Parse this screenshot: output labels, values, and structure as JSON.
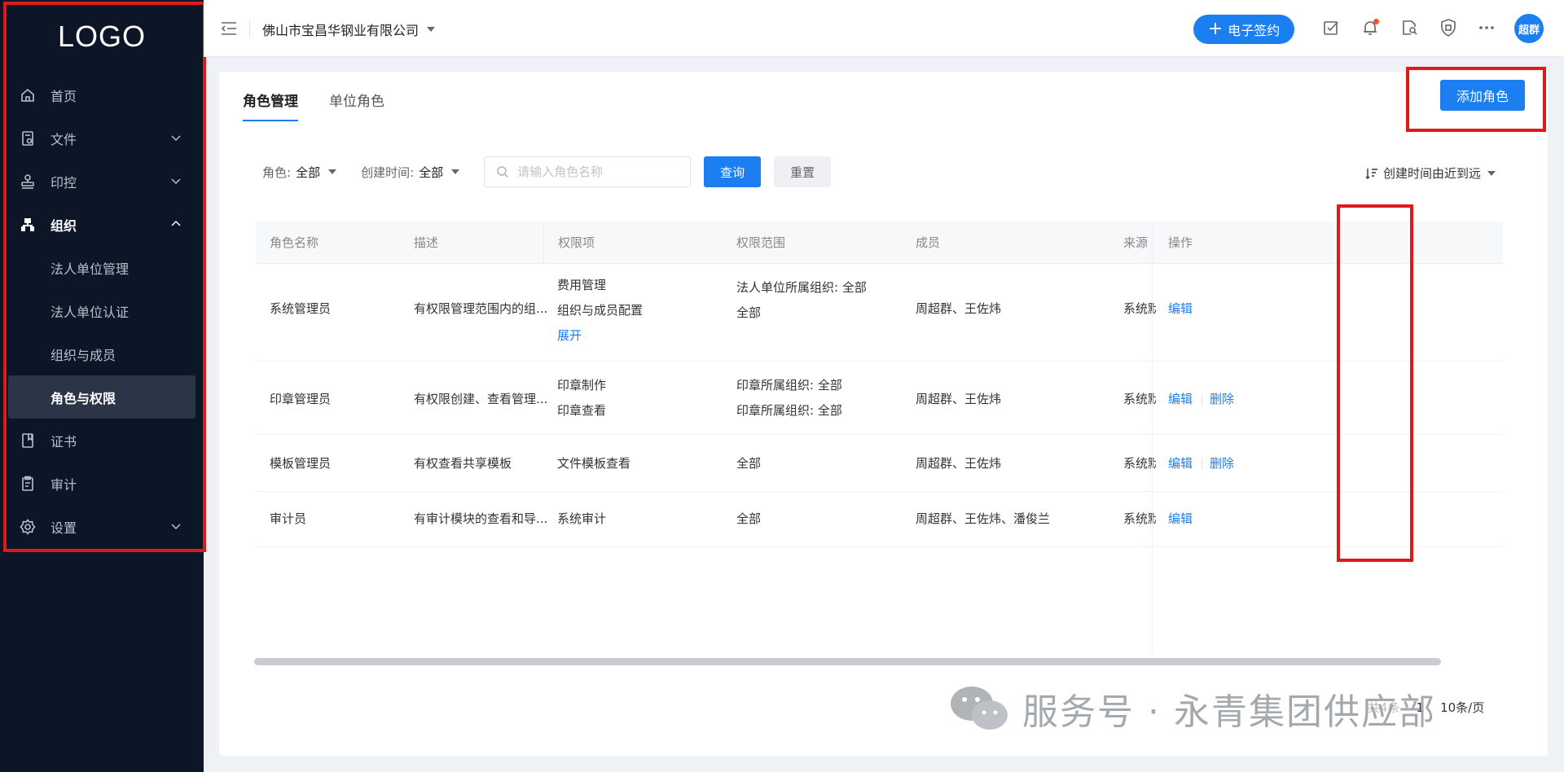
{
  "sidebar": {
    "logo": "LOGO",
    "items": [
      {
        "label": "首页",
        "icon": "home-icon"
      },
      {
        "label": "文件",
        "icon": "file-icon"
      },
      {
        "label": "印控",
        "icon": "stamp-icon"
      },
      {
        "label": "组织",
        "icon": "org-icon"
      },
      {
        "label": "证书",
        "icon": "certificate-icon"
      },
      {
        "label": "审计",
        "icon": "audit-icon"
      },
      {
        "label": "设置",
        "icon": "gear-icon"
      }
    ],
    "org_sub": [
      "法人单位管理",
      "法人单位认证",
      "组织与成员",
      "角色与权限"
    ]
  },
  "header": {
    "company": "佛山市宝昌华钢业有限公司",
    "esign_label": "电子签约",
    "avatar_text": "超群"
  },
  "tabs": [
    "角色管理",
    "单位角色"
  ],
  "add_role_label": "添加角色",
  "filters": {
    "role_label": "角色:",
    "role_value": "全部",
    "time_label": "创建时间:",
    "time_value": "全部",
    "search_placeholder": "请输入角色名称",
    "query_label": "查询",
    "reset_label": "重置",
    "sort_label": "创建时间由近到远"
  },
  "table": {
    "headers": [
      "角色名称",
      "描述",
      "权限项",
      "权限范围",
      "成员",
      "来源",
      "操作"
    ],
    "rows": [
      {
        "name": "系统管理员",
        "desc": "有权限管理范围内的组...",
        "perms": [
          "费用管理",
          "组织与成员配置"
        ],
        "expand": "展开",
        "scope": [
          "法人单位所属组织: 全部",
          "全部"
        ],
        "members": "周超群、王佐炜",
        "source": "系统默",
        "edit": "编辑"
      },
      {
        "name": "印章管理员",
        "desc": "有权限创建、查看管理...",
        "perms": [
          "印章制作",
          "印章查看"
        ],
        "scope": [
          "印章所属组织: 全部",
          "印章所属组织: 全部"
        ],
        "members": "周超群、王佐炜",
        "source": "系统默",
        "edit": "编辑",
        "delete": "删除"
      },
      {
        "name": "模板管理员",
        "desc": "有权查看共享模板",
        "perms": [
          "文件模板查看"
        ],
        "scope": [
          "全部"
        ],
        "members": "周超群、王佐炜",
        "source": "系统默",
        "edit": "编辑",
        "delete": "删除"
      },
      {
        "name": "审计员",
        "desc": "有审计模块的查看和导...",
        "perms": [
          "系统审计"
        ],
        "scope": [
          "全部"
        ],
        "members": "周超群、王佐炜、潘俊兰",
        "source": "系统默",
        "edit": "编辑"
      }
    ]
  },
  "pager": {
    "total": "共4条",
    "page": "1",
    "per_page": "10条/页"
  },
  "watermark": "服务号 · 永青集团供应部",
  "colors": {
    "primary": "#1b7ff1",
    "sidebar_bg": "#0d1627",
    "annotation": "#e01919"
  }
}
